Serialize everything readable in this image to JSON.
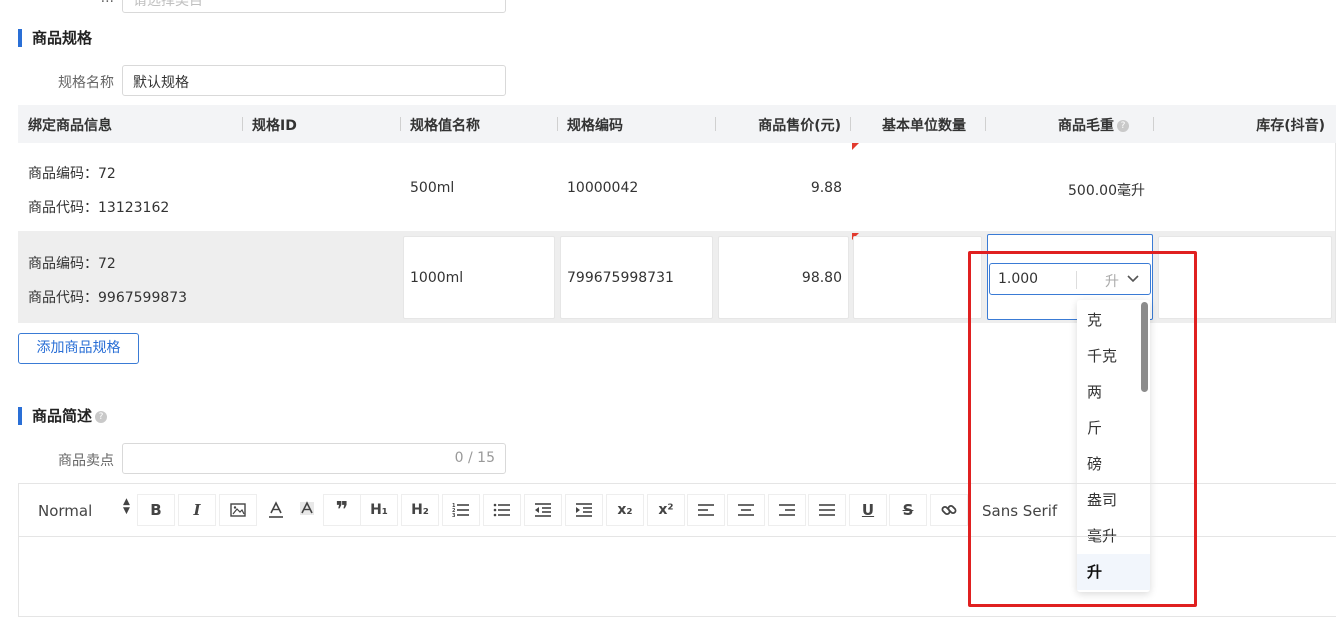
{
  "top_field": {
    "label": "...",
    "placeholder": "请选择类目"
  },
  "spec_section": {
    "title": "商品规格",
    "name_label": "规格名称",
    "name_value": "默认规格"
  },
  "table": {
    "headers": [
      "绑定商品信息",
      "规格ID",
      "规格值名称",
      "规格编码",
      "商品售价(元)",
      "基本单位数量",
      "商品毛重",
      "库存(抖音)"
    ],
    "rows": [
      {
        "code_label": "商品编码：",
        "code": "72",
        "product_code_label": "商品代码：",
        "product_code": "13123162",
        "spec_value": "500ml",
        "spec_code": "10000042",
        "price": "9.88",
        "gross_weight": "500.00毫升"
      },
      {
        "code_label": "商品编码：",
        "code": "72",
        "product_code_label": "商品代码：",
        "product_code": "9967599873",
        "spec_value": "1000ml",
        "spec_code": "799675998731",
        "price": "98.80",
        "gross_weight_value": "1.000",
        "gross_weight_unit": "升"
      }
    ]
  },
  "add_button": "添加商品规格",
  "desc_section": {
    "title": "商品简述",
    "selling_label": "商品卖点",
    "selling_counter": "0 / 15"
  },
  "editor": {
    "format": "Normal",
    "font": "Sans Serif"
  },
  "unit_dropdown": {
    "options": [
      "克",
      "千克",
      "两",
      "斤",
      "磅",
      "盎司",
      "毫升",
      "升"
    ],
    "selected": "升"
  },
  "colors": {
    "accent": "#2a6fd6",
    "highlight": "#e02020"
  }
}
